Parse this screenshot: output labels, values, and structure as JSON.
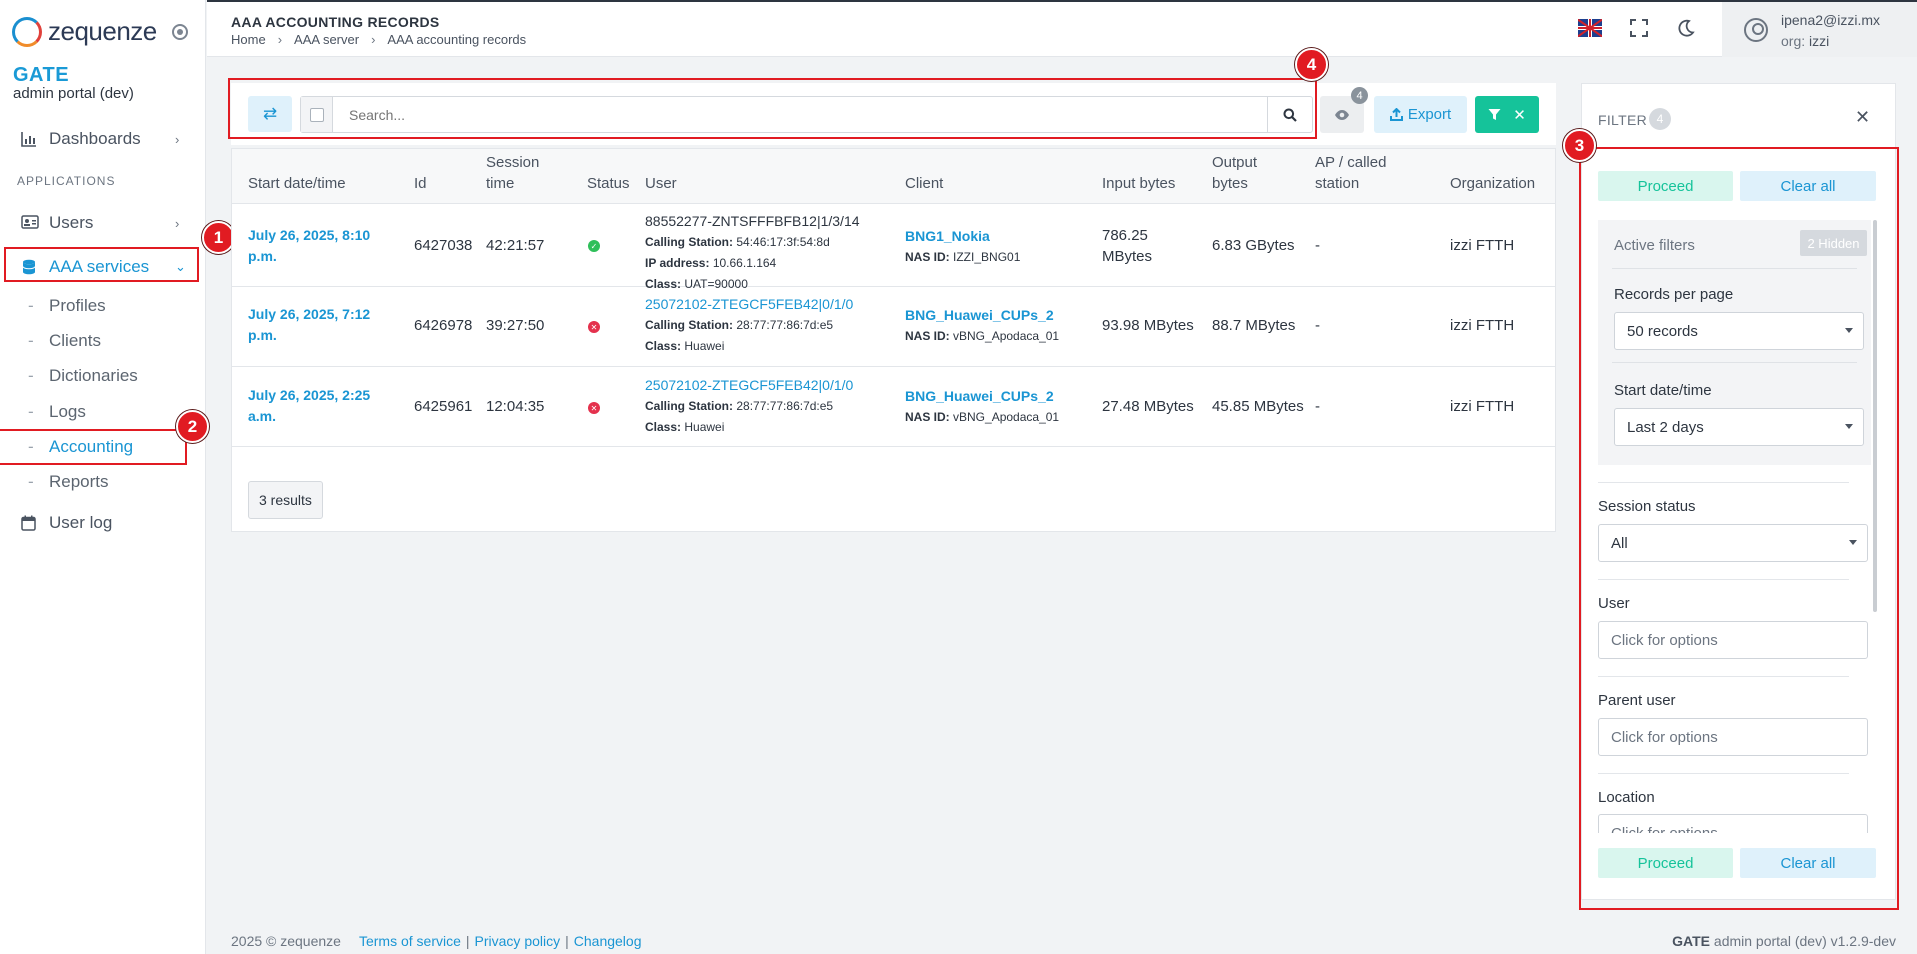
{
  "app": {
    "logo_text": "zequenze",
    "brand": "GATE",
    "brand_sub": "admin portal (dev)"
  },
  "sidebar": {
    "dashboards": "Dashboards",
    "section_label": "APPLICATIONS",
    "users": "Users",
    "aaa_services": "AAA services",
    "sub_items": [
      "Profiles",
      "Clients",
      "Dictionaries",
      "Logs",
      "Accounting",
      "Reports"
    ],
    "user_log": "User log"
  },
  "header": {
    "title": "AAA ACCOUNTING RECORDS",
    "breadcrumb": [
      "Home",
      "AAA server",
      "AAA accounting records"
    ],
    "user_email": "ipena2@izzi.mx",
    "org_label": "org:",
    "org_value": "izzi"
  },
  "annotations": [
    "1",
    "2",
    "3",
    "4"
  ],
  "toolbar": {
    "search_placeholder": "Search...",
    "hidden_columns_count": "4",
    "export_label": "Export"
  },
  "table": {
    "headers": {
      "start": "Start date/time",
      "id": "Id",
      "session_line1": "Session",
      "session_line2": "time",
      "status": "Status",
      "user": "User",
      "client": "Client",
      "input": "Input bytes",
      "output_line1": "Output",
      "output_line2": "bytes",
      "ap_line1": "AP / called",
      "ap_line2": "station",
      "org": "Organization"
    },
    "rows": [
      {
        "start_line1": "July 26, 2025, 8:10",
        "start_line2": "p.m.",
        "id": "6427038",
        "session_time": "42:21:57",
        "status": "ok",
        "user": "88552277-ZNTSFFFBFB12|1/3/14",
        "calling_label": "Calling Station:",
        "calling": "54:46:17:3f:54:8d",
        "ip_label": "IP address:",
        "ip": "10.66.1.164",
        "class_label": "Class:",
        "class": "UAT=90000",
        "client": "BNG1_Nokia",
        "nas_label": "NAS ID:",
        "nas": "IZZI_BNG01",
        "input_line1": "786.25",
        "input_line2": "MBytes",
        "output": "6.83 GBytes",
        "ap": "-",
        "org": "izzi FTTH"
      },
      {
        "start_line1": "July 26, 2025, 7:12",
        "start_line2": "p.m.",
        "id": "6426978",
        "session_time": "39:27:50",
        "status": "error",
        "user": "25072102-ZTEGCF5FEB42|0/1/0",
        "calling_label": "Calling Station:",
        "calling": "28:77:77:86:7d:e5",
        "class_label": "Class:",
        "class": "Huawei",
        "client": "BNG_Huawei_CUPs_2",
        "nas_label": "NAS ID:",
        "nas": "vBNG_Apodaca_01",
        "input": "93.98 MBytes",
        "output": "88.7 MBytes",
        "ap": "-",
        "org": "izzi FTTH"
      },
      {
        "start_line1": "July 26, 2025, 2:25",
        "start_line2": "a.m.",
        "id": "6425961",
        "session_time": "12:04:35",
        "status": "error",
        "user": "25072102-ZTEGCF5FEB42|0/1/0",
        "calling_label": "Calling Station:",
        "calling": "28:77:77:86:7d:e5",
        "class_label": "Class:",
        "class": "Huawei",
        "client": "BNG_Huawei_CUPs_2",
        "nas_label": "NAS ID:",
        "nas": "vBNG_Apodaca_01",
        "input": "27.48 MBytes",
        "output": "45.85 MBytes",
        "ap": "-",
        "org": "izzi FTTH"
      }
    ],
    "results": "3 results"
  },
  "filter": {
    "title": "FILTER",
    "badge": "4",
    "proceed": "Proceed",
    "clear_all": "Clear all",
    "active_filters": "Active filters",
    "hidden_badge": "2 Hidden",
    "records_per_page_label": "Records per page",
    "records_per_page_value": "50 records",
    "start_label": "Start date/time",
    "start_value": "Last 2 days",
    "session_status_label": "Session status",
    "session_status_value": "All",
    "user_label": "User",
    "user_placeholder": "Click for options",
    "parent_user_label": "Parent user",
    "parent_user_placeholder": "Click for options",
    "location_label": "Location",
    "location_placeholder": "Click for options"
  },
  "footer": {
    "copyright": "2025 © zequenze",
    "terms": "Terms of service",
    "privacy": "Privacy policy",
    "changelog": "Changelog",
    "brand": "GATE",
    "version": "admin portal (dev) v1.2.9-dev"
  },
  "colors": {
    "accent": "#1a95d3",
    "success": "#15c39a",
    "annotation": "#e11b22",
    "error": "#e4314d"
  }
}
